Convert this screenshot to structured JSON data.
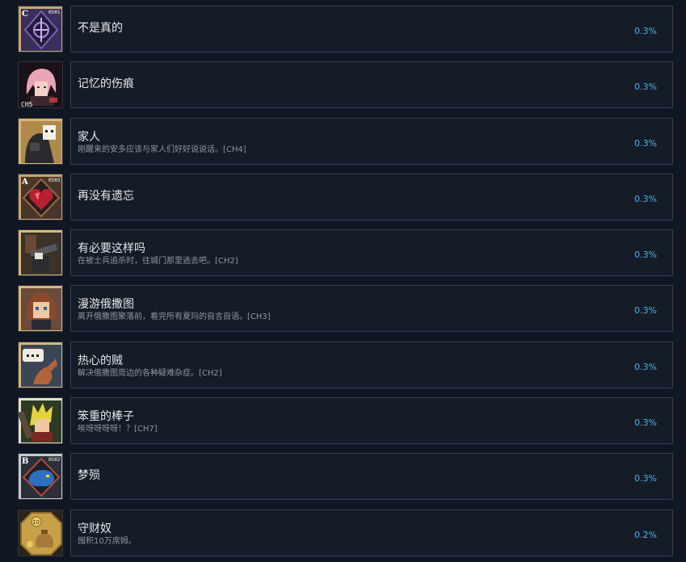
{
  "achievements": [
    {
      "title": "不是真的",
      "description": "",
      "percent": "0.3%",
      "icon": "purple-crest-icon",
      "badge": "C",
      "code": "0501"
    },
    {
      "title": "记忆的伤痕",
      "description": "",
      "percent": "0.3%",
      "icon": "pink-hair-portrait-icon",
      "tag": "CH5"
    },
    {
      "title": "家人",
      "description": "刚醒来的安多应该与家人们好好说说话。[CH4]",
      "percent": "0.3%",
      "icon": "hooded-skull-icon"
    },
    {
      "title": "再没有遗忘",
      "description": "",
      "percent": "0.3%",
      "icon": "red-heart-crystal-icon",
      "badge": "A",
      "code": "0503"
    },
    {
      "title": "有必要这样吗",
      "description": "在被士兵追杀时，往城门那里逃去吧。[CH2]",
      "percent": "0.3%",
      "icon": "cannon-figure-icon"
    },
    {
      "title": "漫游俄撒图",
      "description": "离开俄撒图聚落前，看完所有夏玛的自言自语。[CH3]",
      "percent": "0.3%",
      "icon": "brown-hair-girl-icon"
    },
    {
      "title": "热心的贼",
      "description": "解决俄撒图周边的各种疑难杂症。[CH2]",
      "percent": "0.3%",
      "icon": "speech-bubble-lizard-icon"
    },
    {
      "title": "笨重的棒子",
      "description": "唉呀呀呀呀！？[CH7]",
      "percent": "0.3%",
      "icon": "blonde-warrior-icon"
    },
    {
      "title": "梦殒",
      "description": "",
      "percent": "0.3%",
      "icon": "blue-beast-crest-icon",
      "badge": "B",
      "code": "0502"
    },
    {
      "title": "守财奴",
      "description": "囤积10万席姆。",
      "percent": "0.2%",
      "icon": "gold-coin-bag-icon",
      "coin": "10"
    }
  ]
}
